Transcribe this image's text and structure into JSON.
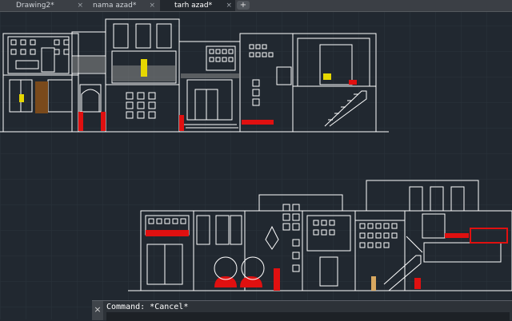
{
  "tabs": [
    {
      "label": "Drawing2*",
      "active": false
    },
    {
      "label": "nama azad*",
      "active": false
    },
    {
      "label": "tarh azad*",
      "active": true
    }
  ],
  "tab_close_glyph": "×",
  "tab_add_glyph": "+",
  "command": {
    "history": "Command: *Cancel*",
    "input_value": "",
    "close_glyph": "×"
  },
  "colors": {
    "background": "#212830",
    "linework": "#ffffff",
    "accent_red": "#e01010",
    "accent_yellow": "#e6d700",
    "wood": "#7a4a1c"
  }
}
